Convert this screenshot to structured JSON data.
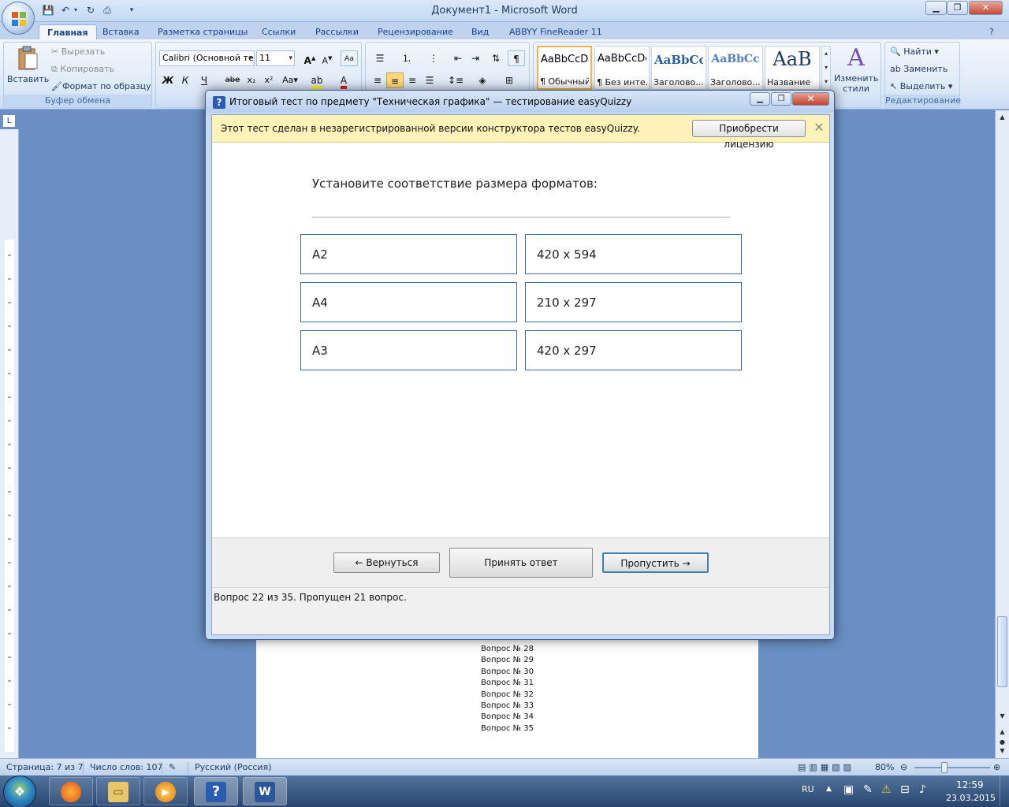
{
  "word": {
    "title": "Документ1 - Microsoft Word",
    "tabs": [
      "Главная",
      "Вставка",
      "Разметка страницы",
      "Ссылки",
      "Рассылки",
      "Рецензирование",
      "Вид",
      "ABBYY FineReader 11"
    ],
    "clipboard": {
      "paste": "Вставить",
      "cut": "Вырезать",
      "copy": "Копировать",
      "format_painter": "Формат по образцу",
      "group_label": "Буфер обмена"
    },
    "font": {
      "name": "Calibri (Основной текст)",
      "size": "11"
    },
    "styles": [
      {
        "sample": "AaBbCcDc",
        "name": "¶ Обычный"
      },
      {
        "sample": "AaBbCcDc",
        "name": "¶ Без инте..."
      },
      {
        "sample": "AaBbCc",
        "name": "Заголово..."
      },
      {
        "sample": "AaBbCc",
        "name": "Заголово..."
      },
      {
        "sample": "AaB",
        "name": "Название"
      }
    ],
    "change_styles": "Изменить стили",
    "editing": {
      "find": "Найти",
      "replace": "Заменить",
      "select": "Выделить",
      "group_label": "Редактирование"
    },
    "page_lines": [
      "Вопрос № 28",
      "Вопрос № 29",
      "Вопрос № 30",
      "Вопрос № 31",
      "Вопрос № 32",
      "Вопрос № 33",
      "Вопрос № 34",
      "Вопрос № 35"
    ],
    "status": {
      "page": "Страница: 7 из 7",
      "words": "Число слов: 107",
      "language": "Русский (Россия)",
      "zoom": "80%"
    }
  },
  "dialog": {
    "title": "Итоговый тест по предмету \"Техническая графика\" — тестирование easyQuizzy",
    "license_notice": "Этот тест сделан в незарегистрированной версии конструктора тестов easyQuizzy.",
    "license_button": "Приобрести лицензию",
    "question": "Установите соответствие размера форматов:",
    "pairs": [
      {
        "left": "A2",
        "right": "420 x 594"
      },
      {
        "left": "A4",
        "right": "210 x 297"
      },
      {
        "left": "A3",
        "right": "420 x 297"
      }
    ],
    "buttons": {
      "back": "← Вернуться",
      "accept": "Принять ответ",
      "skip": "Пропустить →"
    },
    "status": "Вопрос 22 из 35. Пропущен 21 вопрос."
  },
  "taskbar": {
    "lang": "RU",
    "time": "12:59",
    "date": "23.03.2015"
  }
}
